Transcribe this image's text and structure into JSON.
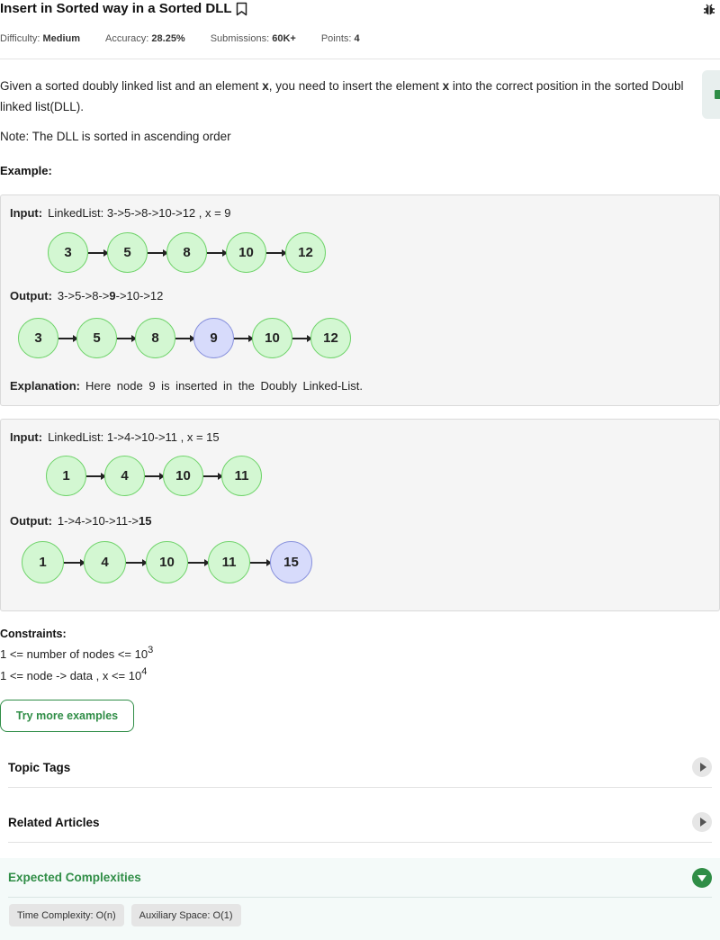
{
  "header": {
    "title": "Insert in Sorted way in a Sorted DLL",
    "difficulty_label": "Difficulty:",
    "difficulty": "Medium",
    "accuracy_label": "Accuracy:",
    "accuracy": "28.25%",
    "submissions_label": "Submissions:",
    "submissions": "60K+",
    "points_label": "Points:",
    "points": "4",
    "icons": [
      "bookmark-icon",
      "bug-report-icon"
    ]
  },
  "problem": {
    "desc_1": "Given a sorted doubly linked list and an element ",
    "x": "x",
    "desc_2": ", you need to insert the element ",
    "desc_3": " into the correct position in the sorted Doubl",
    "desc_line2": "linked list(DLL).",
    "note": "Note: The DLL is sorted in ascending order",
    "example_heading": "Example:"
  },
  "examples": [
    {
      "input_label": "Input:",
      "input_text": "LinkedList:  3->5->8->10->12  ,  x  =  9",
      "input_nodes": [
        "3",
        "5",
        "8",
        "10",
        "12"
      ],
      "output_label": "Output:",
      "output_prefix": "3->5->8->",
      "output_bold": "9",
      "output_suffix": "->10->12",
      "output_nodes": [
        "3",
        "5",
        "8",
        "9",
        "10",
        "12"
      ],
      "highlight": "9",
      "explanation_label": "Explanation:",
      "explanation": "Here node 9 is inserted in the Doubly Linked-List."
    },
    {
      "input_label": "Input:",
      "input_text": "LinkedList:  1->4->10->11  ,  x  =  15",
      "input_nodes": [
        "1",
        "4",
        "10",
        "11"
      ],
      "output_label": "Output:",
      "output_prefix": "1->4->10->11->",
      "output_bold": "15",
      "output_suffix": "",
      "output_nodes": [
        "1",
        "4",
        "10",
        "11",
        "15"
      ],
      "highlight": "15"
    }
  ],
  "constraints": {
    "heading": "Constraints:",
    "line1_text": "1 <= number of nodes <= 10",
    "line1_exp": "3",
    "line2_text": "1 <= node -> data , x <= 10",
    "line2_exp": "4"
  },
  "try_button": "Try more examples",
  "sections": {
    "topic_tags": "Topic Tags",
    "related_articles": "Related Articles",
    "expected_complexities": "Expected Complexities",
    "time_complexity": "Time Complexity: O(n)",
    "aux_space": "Auxiliary Space: O(1)"
  },
  "colors": {
    "accent": "#2f8d46",
    "node_fill": "#d3f7d2",
    "node_border": "#6fd36a",
    "highlight_fill": "#d7dbfb",
    "highlight_border": "#8790dc"
  }
}
